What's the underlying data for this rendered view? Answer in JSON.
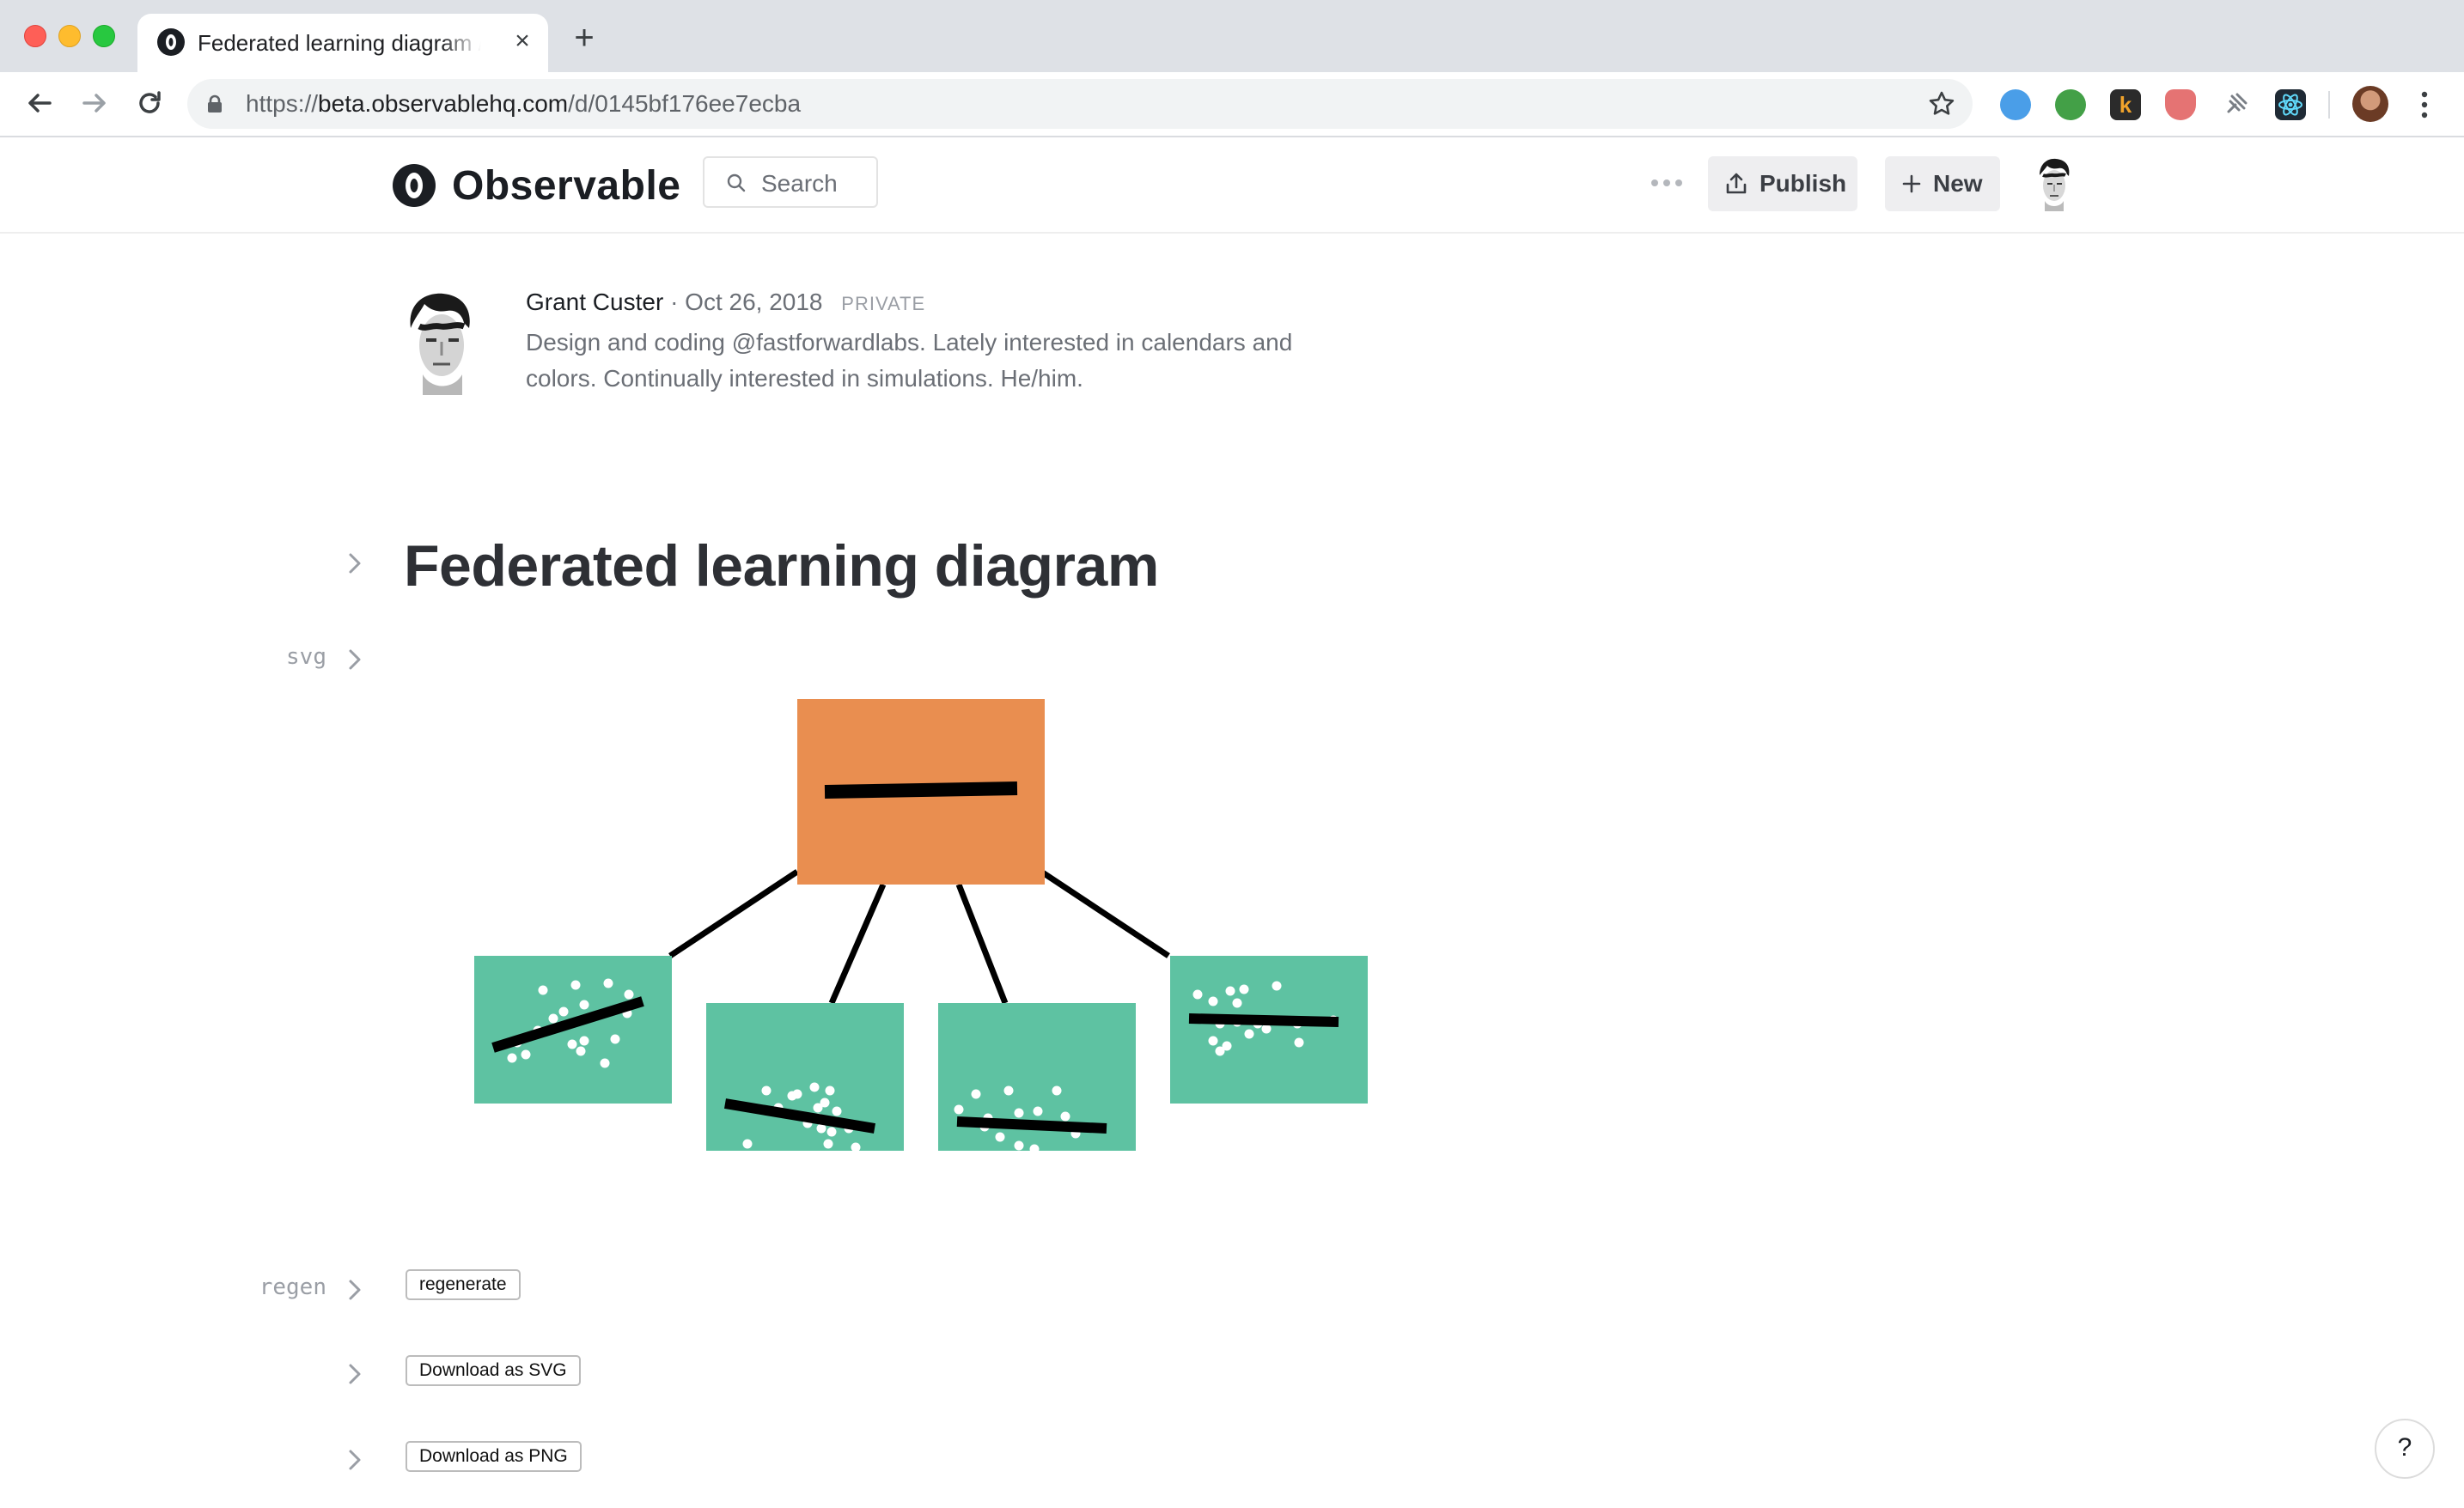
{
  "browser": {
    "tab_title": "Federated learning diagram / Observable",
    "url_scheme": "https://",
    "url_domain": "beta.observablehq.com",
    "url_path": "/d/0145bf176ee7ecba"
  },
  "header": {
    "brand": "Observable",
    "search_label": "Search",
    "publish_label": "Publish",
    "new_label": "New"
  },
  "author": {
    "name": "Grant Custer",
    "separator": "·",
    "date": "Oct 26, 2018",
    "visibility": "PRIVATE",
    "bio": "Design and coding @fastforwardlabs. Lately interested in calendars and colors. Continually interested in simulations. He/him."
  },
  "notebook": {
    "title": "Federated learning diagram",
    "cells": [
      {
        "label": "svg"
      },
      {
        "label": "regen",
        "button": "regenerate"
      },
      {
        "label": "",
        "button": "Download as SVG"
      },
      {
        "label": "",
        "button": "Download as PNG"
      }
    ]
  },
  "diagram": {
    "server_color": "#e98e50",
    "client_color": "#5ec2a2",
    "line_color": "#000000",
    "dot_color": "#ffffff",
    "clients": 4
  },
  "help_label": "?"
}
